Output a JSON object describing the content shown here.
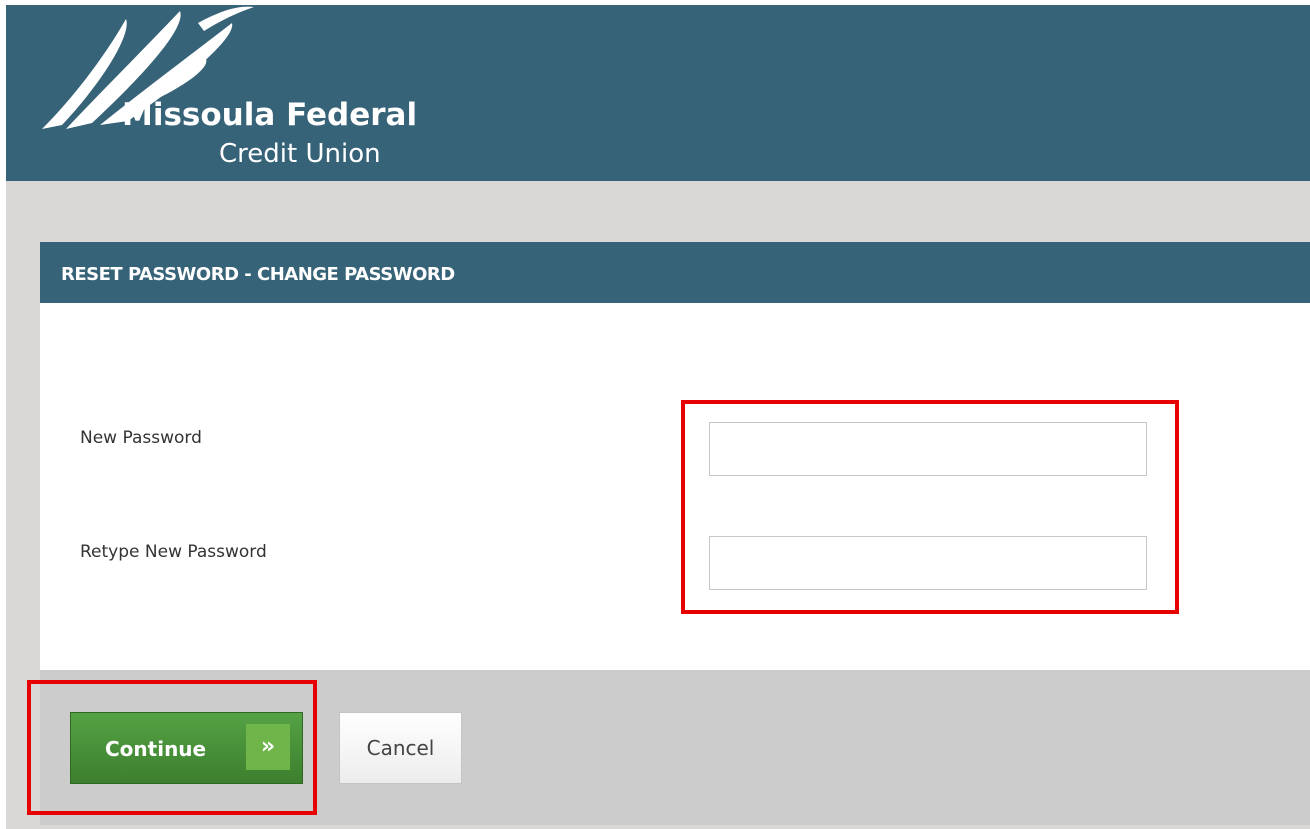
{
  "header": {
    "brand_line1": "Missoula Federal",
    "brand_line2": "Credit Union"
  },
  "panel": {
    "title": "RESET PASSWORD - CHANGE PASSWORD",
    "fields": {
      "new_password": {
        "label": "New Password",
        "value": "",
        "placeholder": ""
      },
      "retype_password": {
        "label": "Retype New Password",
        "value": "",
        "placeholder": ""
      }
    }
  },
  "actions": {
    "continue_label": "Continue",
    "continue_icon": "»",
    "cancel_label": "Cancel"
  },
  "colors": {
    "brand_blue": "#376378",
    "continue_green": "#4a9138",
    "highlight_red": "#e60000"
  },
  "icons": {
    "logo": "swoosh-logo-icon",
    "continue_arrow": "double-chevron-right-icon"
  }
}
